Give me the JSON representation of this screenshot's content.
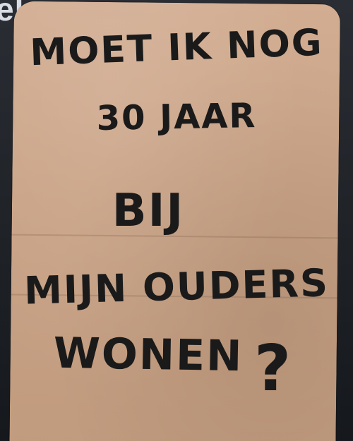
{
  "scene": {
    "background_text": "ele",
    "sign_lines": [
      "MOET IK NOG",
      "30 JAAR",
      "BIJ",
      "MIJN OUDERS",
      "WONEN"
    ],
    "question_mark": "?"
  },
  "colors": {
    "cardboard": "#c9a285",
    "ink": "#1b1a1a",
    "background": "#1c1f24"
  }
}
